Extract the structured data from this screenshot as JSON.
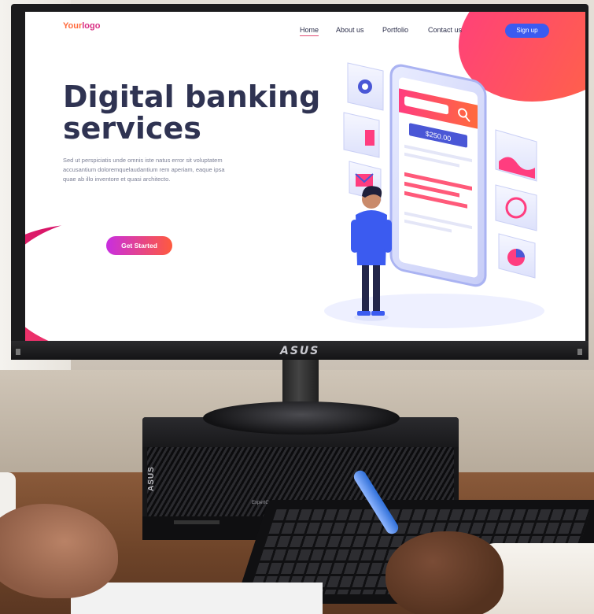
{
  "screen_site": {
    "logo_main": "Your",
    "logo_accent": "logo",
    "nav": [
      "Home",
      "About us",
      "Portfolio",
      "Contact us"
    ],
    "active_nav": "Home",
    "signup_label": "Sign up",
    "hero_title_line1": "Digital banking",
    "hero_title_line2": "services",
    "hero_body": "Sed ut perspiciatis unde omnis iste natus error sit voluptatem accusantium doloremquelaudantium rem aperiam, eaque ipsa quae ab illo inventore et quasi architecto.",
    "cta_label": "Get Started",
    "illustration_badge": "$250.00"
  },
  "monitor": {
    "brand": "ASUS"
  },
  "pc": {
    "brand": "ASUS",
    "label": "ExpertCenter"
  },
  "colors": {
    "accent_pink": "#e14a72",
    "signup_blue": "#3b5bf0",
    "title_navy": "#2f3352"
  },
  "icons": {
    "illustration_gear": "gear-icon",
    "illustration_mail": "mail-icon",
    "illustration_search": "search-icon",
    "illustration_pie": "pie-chart-icon"
  }
}
